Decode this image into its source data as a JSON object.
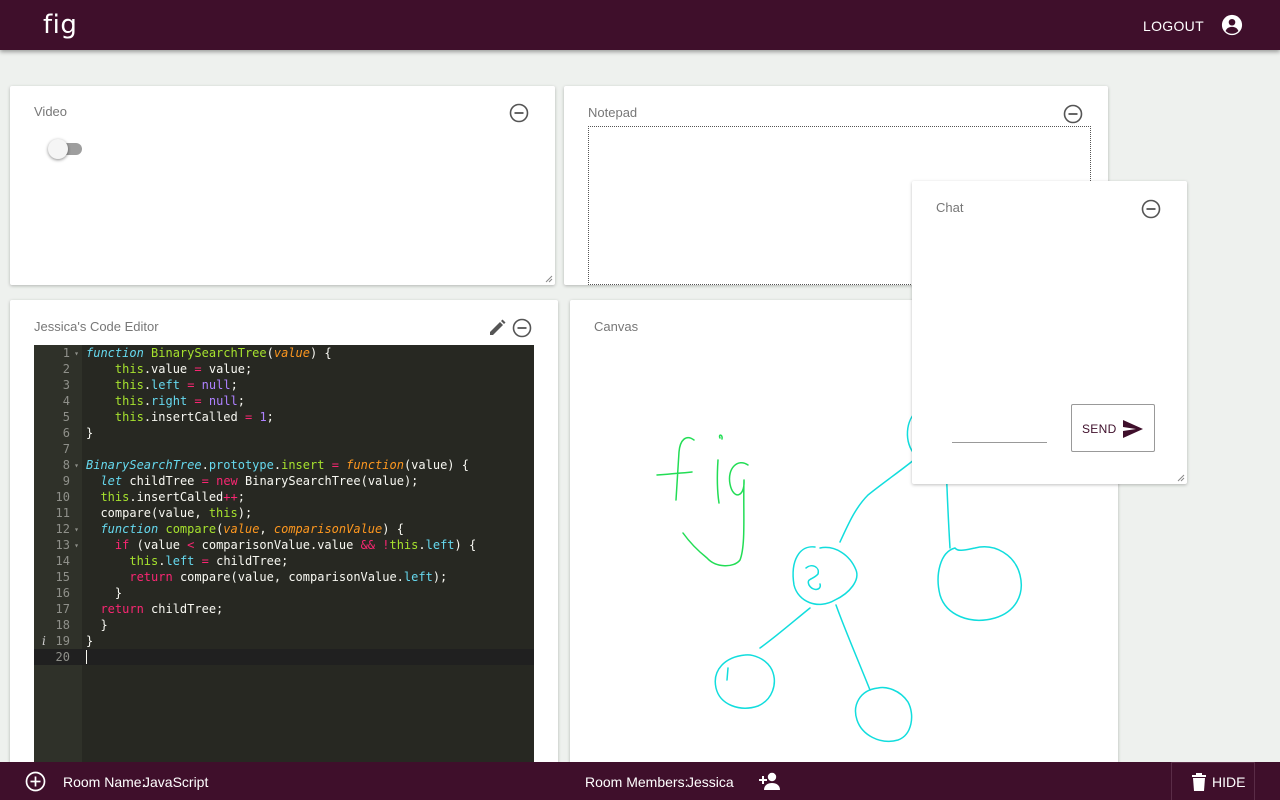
{
  "header": {
    "logo": "fig",
    "logout_label": "LOGOUT",
    "account_icon": "account-circle-icon"
  },
  "panels": {
    "video": {
      "title": "Video",
      "toggle_on": false
    },
    "notepad": {
      "title": "Notepad",
      "value": ""
    },
    "chat": {
      "title": "Chat",
      "input_value": "",
      "send_label": "SEND"
    },
    "editor": {
      "title": "Jessica's Code Editor",
      "active_line": 20
    },
    "canvas": {
      "title": "Canvas",
      "stroke_colors": [
        "#22dd55",
        "#11dddd"
      ]
    }
  },
  "footer": {
    "room_name_label": "Room Name:",
    "room_name": "JavaScript",
    "members_label": "Room Members:",
    "members": "Jessica",
    "hide_label": "HIDE"
  },
  "code_lines": [
    "function BinarySearchTree(value) {",
    "    this.value = value;",
    "    this.left = null;",
    "    this.right = null;",
    "    this.insertCalled = 1;",
    "}",
    "",
    "BinarySearchTree.prototype.insert = function(value) {",
    "  let childTree = new BinarySearchTree(value);",
    "  this.insertCalled++;",
    "  compare(value, this);",
    "  function compare(value, comparisonValue) {",
    "    if (value < comparisonValue.value && !this.left) {",
    "      this.left = childTree;",
    "      return compare(value, comparisonValue.left);",
    "    }",
    "  return childTree;",
    "  }",
    "}",
    ""
  ],
  "colors": {
    "brand": "#3f0f2b",
    "code_bg": "#272822"
  }
}
